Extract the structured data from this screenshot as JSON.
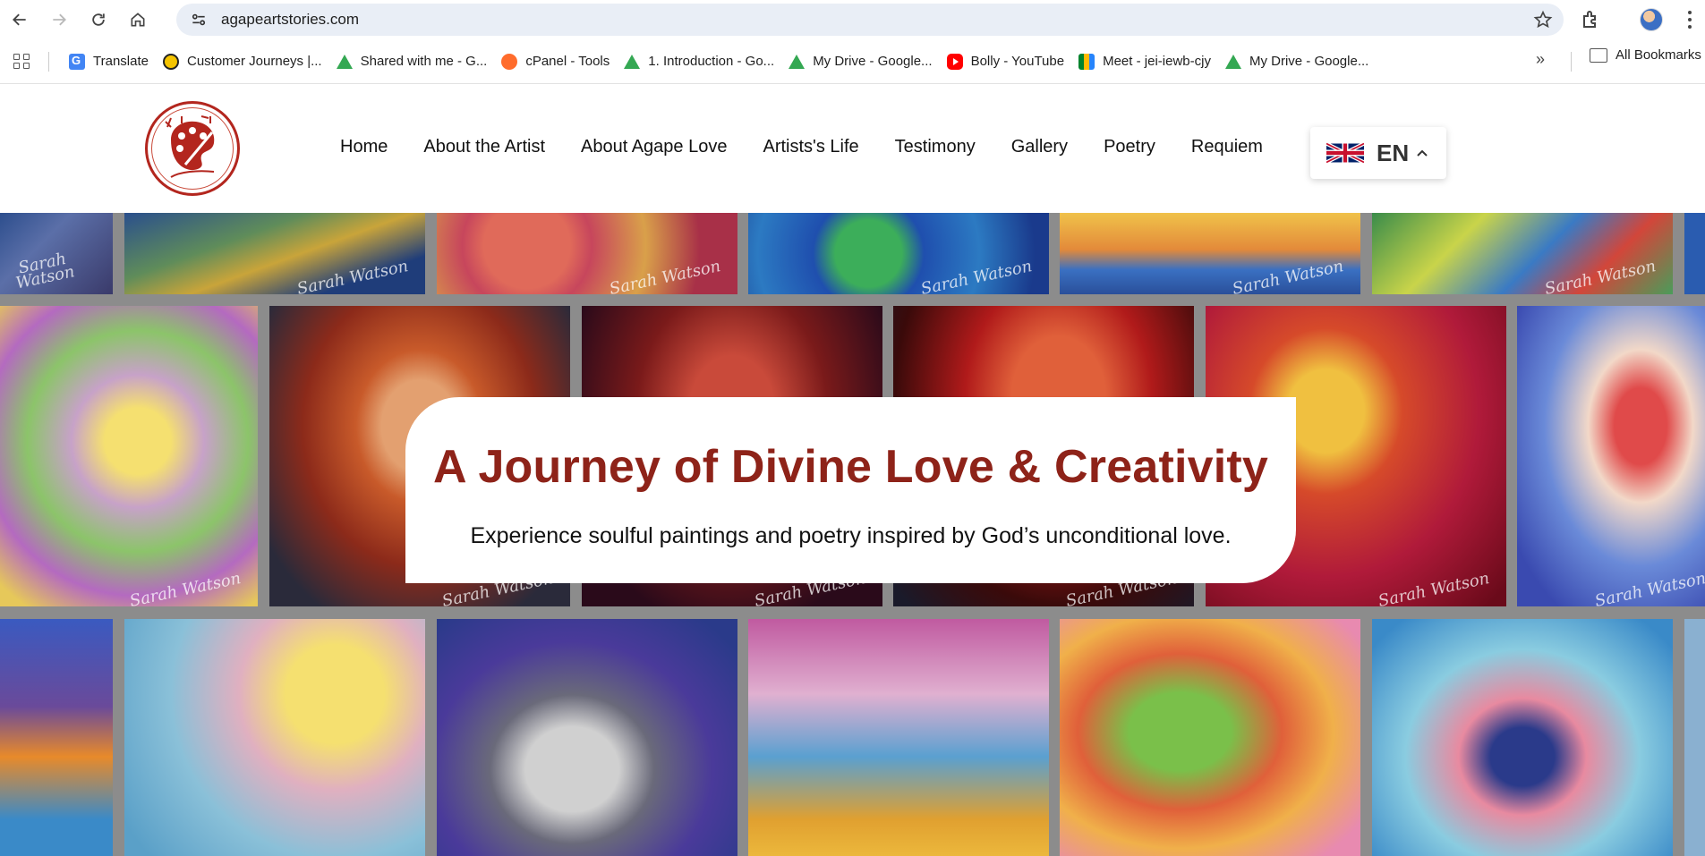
{
  "browser": {
    "url": "agapeartstories.com",
    "bookmarks": [
      {
        "label": "Translate",
        "icon": "google-translate-icon"
      },
      {
        "label": "Customer Journeys |...",
        "icon": "coin-icon"
      },
      {
        "label": "Shared with me - G...",
        "icon": "google-drive-icon"
      },
      {
        "label": "cPanel - Tools",
        "icon": "cpanel-icon"
      },
      {
        "label": "1. Introduction - Go...",
        "icon": "google-drive-icon"
      },
      {
        "label": "My Drive - Google...",
        "icon": "google-drive-icon"
      },
      {
        "label": "Bolly - YouTube",
        "icon": "youtube-icon"
      },
      {
        "label": "Meet - jei-iewb-cjy",
        "icon": "google-meet-icon"
      },
      {
        "label": "My Drive - Google...",
        "icon": "google-drive-icon"
      }
    ],
    "more_bookmarks": "»",
    "all_bookmarks": "All Bookmarks"
  },
  "site": {
    "logo_alt": "Agape Art Stories",
    "nav": [
      "Home",
      "About the Artist",
      "About Agape Love",
      "Artists's Life",
      "Testimony",
      "Gallery",
      "Poetry",
      "Requiem"
    ],
    "language": "EN"
  },
  "hero": {
    "title": "A Journey of Divine Love & Creativity",
    "subtitle": "Experience soulful paintings and poetry inspired by God’s unconditional love.",
    "watermark": "Sarah Watson"
  },
  "colors": {
    "brand_red": "#8e2319",
    "overlay_gray": "#8c8c8c"
  }
}
